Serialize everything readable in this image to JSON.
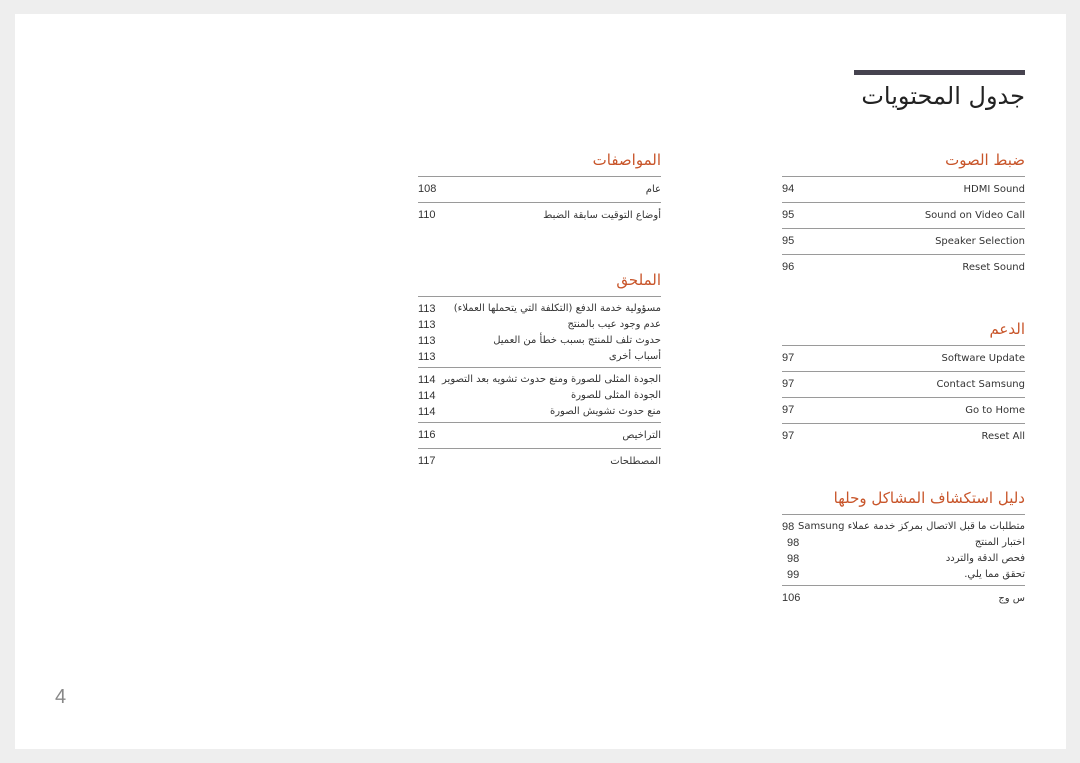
{
  "document": {
    "title": "جدول المحتويات",
    "page_number": "4",
    "heading_color": "#c8552a"
  },
  "right_column": {
    "sound": {
      "heading": "ضبط الصوت",
      "items": [
        {
          "label": "HDMI Sound",
          "page": "94"
        },
        {
          "label": "Sound on Video Call",
          "page": "95"
        },
        {
          "label": "Speaker Selection",
          "page": "95"
        },
        {
          "label": "Reset Sound",
          "page": "96"
        }
      ]
    },
    "support": {
      "heading": "الدعم",
      "items": [
        {
          "label": "Software Update",
          "page": "97"
        },
        {
          "label": "Contact Samsung",
          "page": "97"
        },
        {
          "label": "Go to Home",
          "page": "97"
        },
        {
          "label": "Reset All",
          "page": "97"
        }
      ]
    },
    "troubleshooting": {
      "heading": "دليل استكشاف المشاكل وحلها",
      "groups": [
        [
          {
            "label": "متطلبات ما قبل الاتصال بمركز خدمة عملاء Samsung",
            "page": "98"
          },
          {
            "label": "اختبار المنتج",
            "page": "98"
          },
          {
            "label": "فحص الدقة والتردد",
            "page": "98"
          },
          {
            "label": "تحقق مما يلي.",
            "page": "99"
          }
        ],
        [
          {
            "label": "س وج",
            "page": "106"
          }
        ]
      ]
    }
  },
  "middle_column": {
    "specifications": {
      "heading": "المواصفات",
      "items": [
        {
          "label": "عام",
          "page": "108"
        },
        {
          "label": "أوضاع التوقيت سابقة الضبط",
          "page": "110"
        }
      ]
    },
    "appendix": {
      "heading": "الملحق",
      "groups": [
        [
          {
            "label": "مسؤولية خدمة الدفع (التكلفة التي يتحملها العملاء)",
            "page": "113"
          },
          {
            "label": "عدم وجود عيب بالمنتج",
            "page": "113"
          },
          {
            "label": "حدوث تلف للمنتج بسبب خطأ من العميل",
            "page": "113"
          },
          {
            "label": "أسباب أخرى",
            "page": "113"
          }
        ],
        [
          {
            "label": "الجودة المثلى للصورة ومنع حدوث تشويه بعد التصوير",
            "page": "114"
          },
          {
            "label": "الجودة المثلى للصورة",
            "page": "114"
          },
          {
            "label": "منع حدوث تشويش الصورة",
            "page": "114"
          }
        ],
        [
          {
            "label": "التراخيص",
            "page": "116"
          }
        ],
        [
          {
            "label": "المصطلحات",
            "page": "117"
          }
        ]
      ]
    }
  }
}
